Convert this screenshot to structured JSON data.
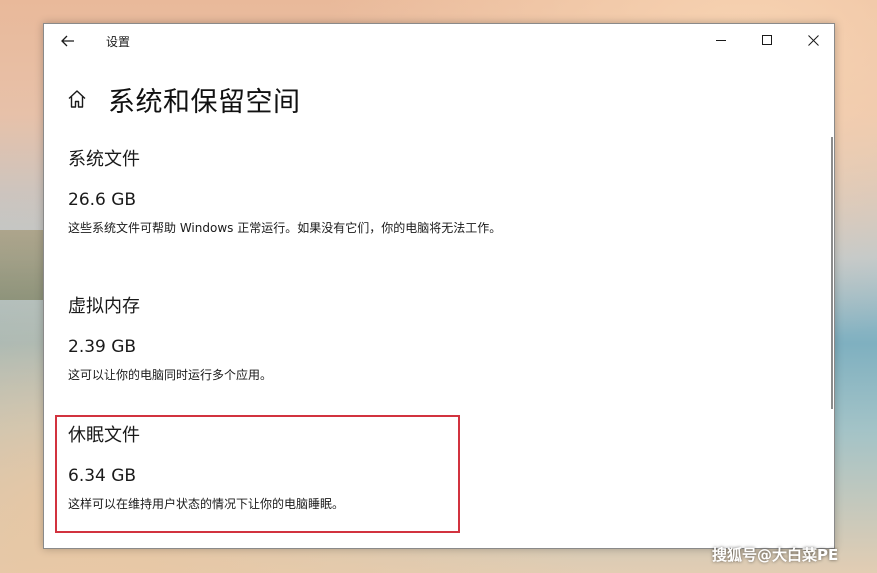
{
  "window": {
    "title": "设置",
    "page_title": "系统和保留空间"
  },
  "icons": {
    "back": "back-arrow-icon",
    "home": "home-icon",
    "minimize": "minimize-icon",
    "maximize": "maximize-icon",
    "close": "close-icon"
  },
  "sections": [
    {
      "title": "系统文件",
      "size": "26.6 GB",
      "description": "这些系统文件可帮助 Windows 正常运行。如果没有它们，你的电脑将无法工作。"
    },
    {
      "title": "虚拟内存",
      "size": "2.39 GB",
      "description": "这可以让你的电脑同时运行多个应用。"
    },
    {
      "title": "休眠文件",
      "size": "6.34 GB",
      "description": "这样可以在维持用户状态的情况下让你的电脑睡眠。"
    }
  ],
  "highlight_color": "#d2333f",
  "watermark": "搜狐号@大白菜PE"
}
